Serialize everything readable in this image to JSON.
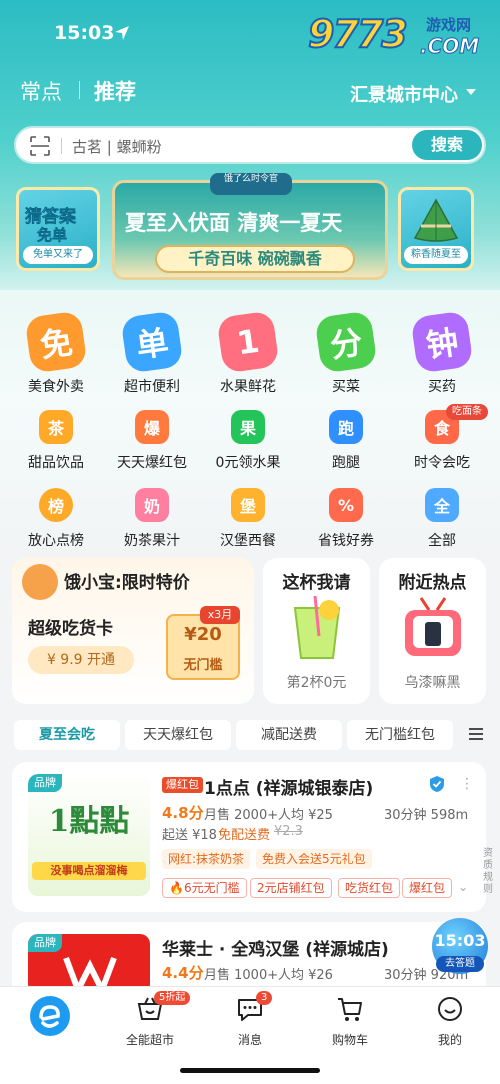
{
  "status_bar": {
    "time": "15:03"
  },
  "watermark": {
    "number": "9773",
    "line1": "游戏网",
    "line2": ".COM"
  },
  "header": {
    "tabs": [
      {
        "label": "常点"
      },
      {
        "label": "推荐"
      }
    ],
    "location": "汇景城市中心"
  },
  "search": {
    "placeholder": "古茗 | 螺蛳粉",
    "button": "搜索"
  },
  "banners": {
    "left": {
      "line1": "猜答案",
      "line2": "免单",
      "pill": "免单又来了"
    },
    "main": {
      "tag": "饿了么时令官",
      "title": "夏至入伏面 清爽一夏天",
      "subtitle": "千奇百味 碗碗飘香"
    },
    "right": {
      "pill": "粽香随夏至"
    }
  },
  "categories_big": [
    {
      "glyph": "免",
      "label": "美食外卖",
      "color": "#ff9a2e"
    },
    {
      "glyph": "单",
      "label": "超市便利",
      "color": "#3aa6ff"
    },
    {
      "glyph": "1",
      "label": "水果鲜花",
      "color": "#ff6f7f"
    },
    {
      "glyph": "分",
      "label": "买菜",
      "color": "#4ccf4f"
    },
    {
      "glyph": "钟",
      "label": "买药",
      "color": "#b06bff"
    }
  ],
  "categories_row2": [
    {
      "glyph": "茶",
      "label": "甜品饮品",
      "color": "#ffa928",
      "badge": ""
    },
    {
      "glyph": "爆",
      "label": "天天爆红包",
      "color": "#ff7a3c",
      "badge": ""
    },
    {
      "glyph": "果",
      "label": "0元领水果",
      "color": "#23c45a",
      "badge": ""
    },
    {
      "glyph": "跑",
      "label": "跑腿",
      "color": "#2f8fff",
      "badge": ""
    },
    {
      "glyph": "食",
      "label": "时令会吃",
      "color": "#ff6948",
      "badge": "吃面条"
    }
  ],
  "categories_row3": [
    {
      "glyph": "榜",
      "label": "放心点榜",
      "color": "#ffa928"
    },
    {
      "glyph": "奶",
      "label": "奶茶果汁",
      "color": "#ff7fa0"
    },
    {
      "glyph": "堡",
      "label": "汉堡西餐",
      "color": "#ffb22e"
    },
    {
      "glyph": "%",
      "label": "省钱好券",
      "color": "#ff6a4d"
    },
    {
      "glyph": "全",
      "label": "全部",
      "color": "#4fa9ff"
    }
  ],
  "promo": {
    "card1": {
      "title": "饿小宝:限时特价",
      "heading": "超级吃货卡",
      "button": "¥ 9.9 开通",
      "coupon_badge": "x3月",
      "coupon_amount": "¥20",
      "coupon_label": "无门槛"
    },
    "card2": {
      "title": "这杯我请",
      "subtitle": "第2杯0元"
    },
    "card3": {
      "title": "附近热点",
      "subtitle": "乌漆嘛黑"
    }
  },
  "filter_tabs": [
    "夏至会吃",
    "天天爆红包",
    "减配送费",
    "无门槛红包"
  ],
  "stores": [
    {
      "tag": "品牌",
      "hot_tag": "爆红包",
      "name": "1点点 (祥源城银泰店)",
      "rating": "4.8分",
      "sales": "月售 2000+",
      "avg": "人均 ¥25",
      "time_distance": "30分钟 598m",
      "min_order": "起送 ¥18",
      "delivery": "免配送费",
      "old_fee": "¥2.3",
      "chips_row1": [
        "网红:抹茶奶茶",
        "免费入会送5元礼包"
      ],
      "chips_row2": [
        "6元无门槛",
        "2元店铺红包",
        "吃货红包",
        "爆红包"
      ],
      "logo_text": "1點點",
      "slogan": "没事喝点溜溜梅"
    },
    {
      "tag": "品牌",
      "name": "华莱士 · 全鸡汉堡 (祥源城店)",
      "rating": "4.4分",
      "sales": "月售 1000+",
      "avg": "人均 ¥26",
      "time_distance": "30分钟 920m"
    }
  ],
  "floating_timer": {
    "time": "15:03",
    "label": "去答题"
  },
  "side_label": "资质规则",
  "bottom_nav": [
    {
      "label": "",
      "badge": ""
    },
    {
      "label": "全能超市",
      "badge": "5折起"
    },
    {
      "label": "消息",
      "badge": "3"
    },
    {
      "label": "购物车",
      "badge": ""
    },
    {
      "label": "我的",
      "badge": ""
    }
  ],
  "colors": {
    "brand": "#2ab6bc",
    "accent_orange": "#f07a1a",
    "accent_red": "#e94d2a"
  }
}
